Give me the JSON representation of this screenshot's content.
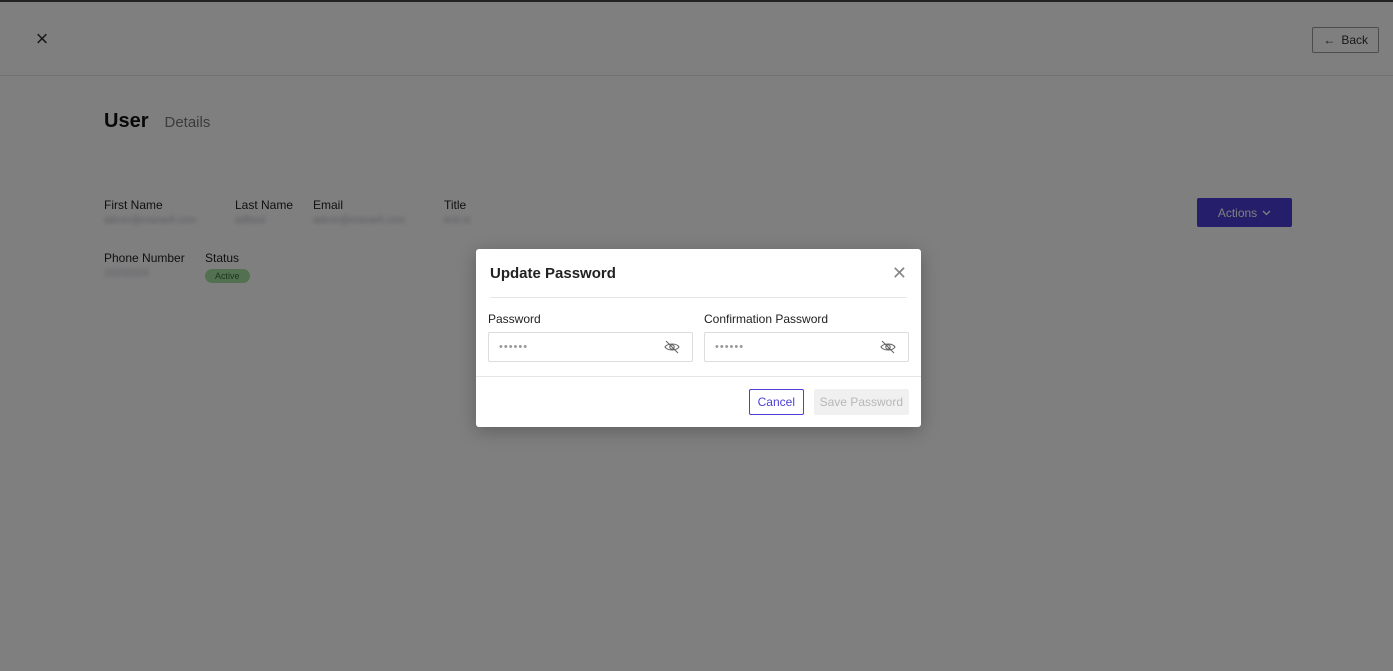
{
  "header": {
    "close_icon": "close-icon",
    "back_label": "Back",
    "back_icon": "arrow-left-icon"
  },
  "page": {
    "title": "User",
    "subtitle": "Details"
  },
  "user": {
    "first_name_label": "First Name",
    "first_name_value": "admin@maraefi.com",
    "last_name_label": "Last Name",
    "last_name_value": "adfasd",
    "email_label": "Email",
    "email_value": "admin@maraefi.com",
    "title_label": "Title",
    "title_value": "test ts",
    "phone_label": "Phone Number",
    "phone_value": "23232323",
    "status_label": "Status",
    "status_value": "Active"
  },
  "actions": {
    "label": "Actions",
    "icon": "chevron-down-icon",
    "color": "#4b3fd6"
  },
  "modal": {
    "title": "Update Password",
    "password_label": "Password",
    "password_value": "••••••",
    "confirm_label": "Confirmation Password",
    "confirm_value": "••••••",
    "eye_icon": "eye-off-icon",
    "cancel_label": "Cancel",
    "save_label": "Save Password"
  }
}
